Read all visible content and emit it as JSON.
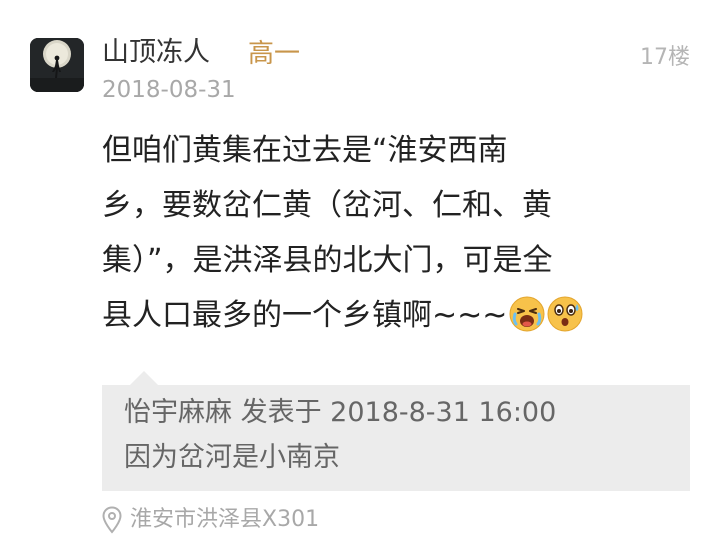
{
  "post": {
    "user": {
      "name": "山顶冻人",
      "level": "高一",
      "avatar_icon": "avatar-moon-silhouette"
    },
    "floor": "17楼",
    "date": "2018-08-31",
    "content_lines": [
      "但咱们黄集在过去是“淮安西南",
      "乡，要数岔仁黄（岔河、仁和、黄",
      "集）”，是洪泽县的北大门，可是全",
      "县人口最多的一个乡镇啊~~~"
    ],
    "content_emojis": [
      "crying-face-emoji",
      "astonished-face-emoji"
    ],
    "quote": {
      "meta": "怡宇麻麻 发表于 2018-8-31 16:00",
      "text": "因为岔河是小南京"
    },
    "location": {
      "icon": "location-pin-icon",
      "text": "淮安市洪泽县X301"
    },
    "colors": {
      "level": "#c8954a",
      "quote_bg": "#ececec",
      "meta_gray": "#a8a8a8",
      "body_text": "#222222"
    }
  }
}
